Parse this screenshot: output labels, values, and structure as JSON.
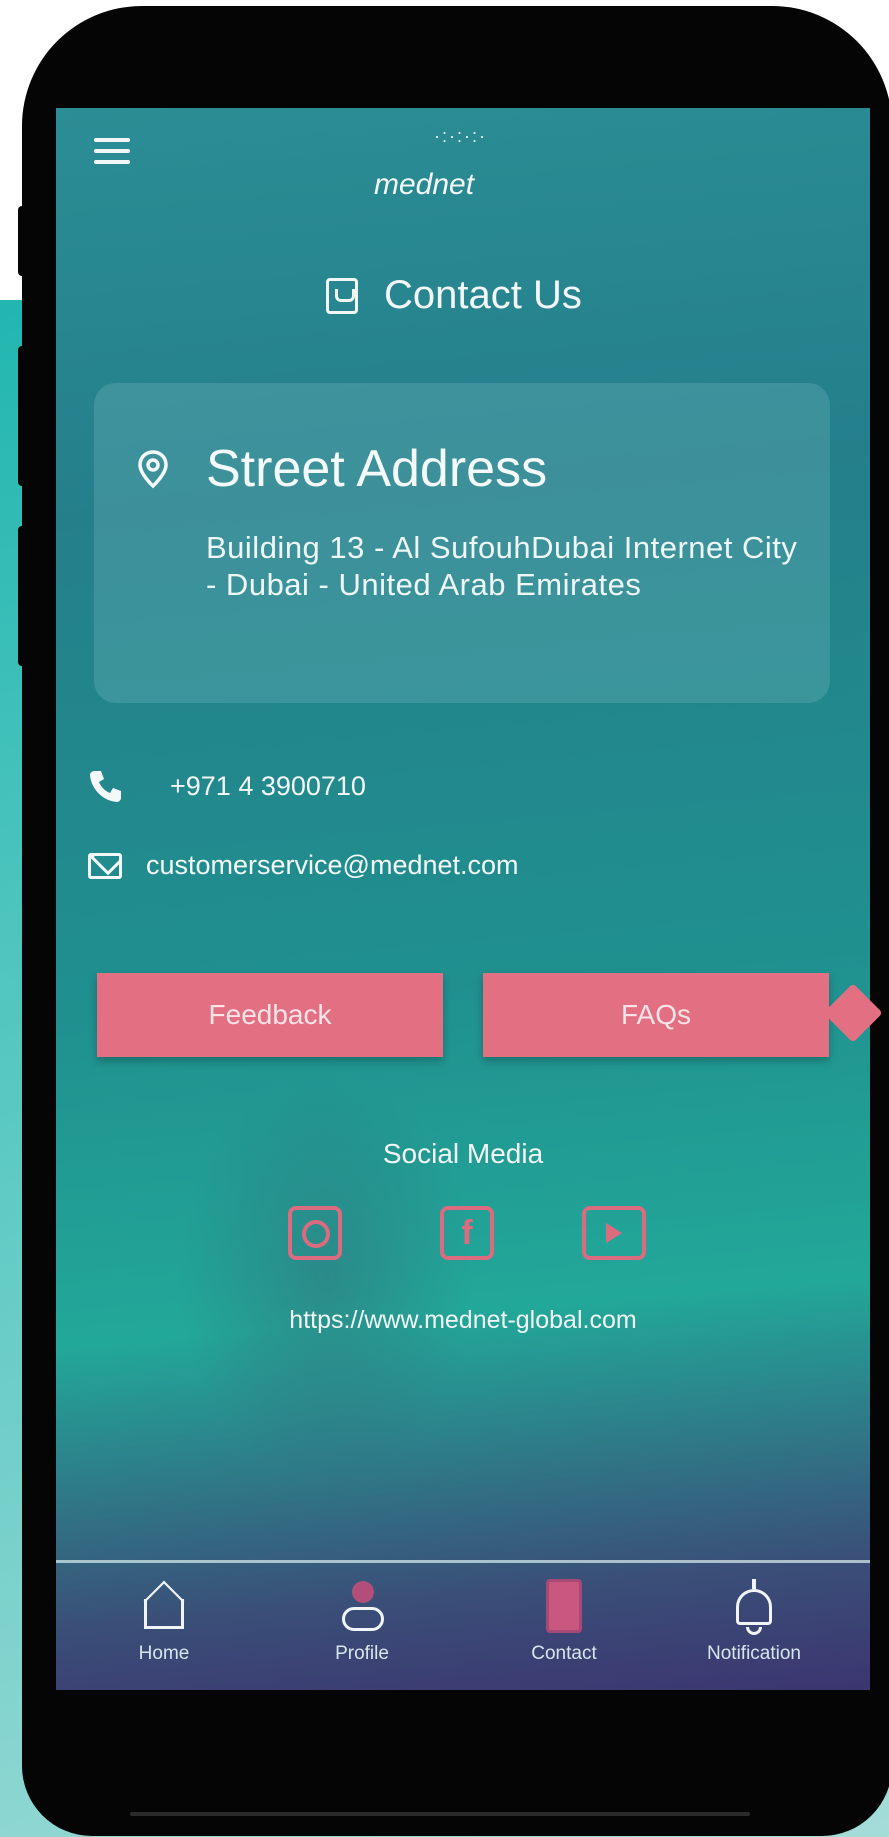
{
  "app": {
    "logo": "mednet",
    "colors": {
      "accent": "#e36f82",
      "screen_top": "#2b8d95",
      "screen_bottom": "#3c3570",
      "background_accent": "#22b6b0"
    }
  },
  "header": {
    "menu_icon": "menu-icon",
    "title": "Contact Us",
    "title_icon": "phone-card-icon"
  },
  "address": {
    "heading": "Street Address",
    "icon": "location-pin-icon",
    "text": "Building 13 - Al SufouhDubai Internet City - Dubai - United Arab Emirates"
  },
  "contact": {
    "phone": "+971 4 3900710",
    "email": "customerservice@mednet.com"
  },
  "buttons": {
    "feedback": "Feedback",
    "faqs": "FAQs"
  },
  "social": {
    "title": "Social Media",
    "icons": [
      "instagram-icon",
      "facebook-icon",
      "youtube-icon"
    ],
    "facebook_glyph": "f",
    "website": "https://www.mednet-global.com"
  },
  "tabs": [
    {
      "label": "Home",
      "icon": "home-icon"
    },
    {
      "label": "Profile",
      "icon": "profile-icon"
    },
    {
      "label": "Contact",
      "icon": "contact-icon"
    },
    {
      "label": "Notification",
      "icon": "bell-icon"
    }
  ]
}
